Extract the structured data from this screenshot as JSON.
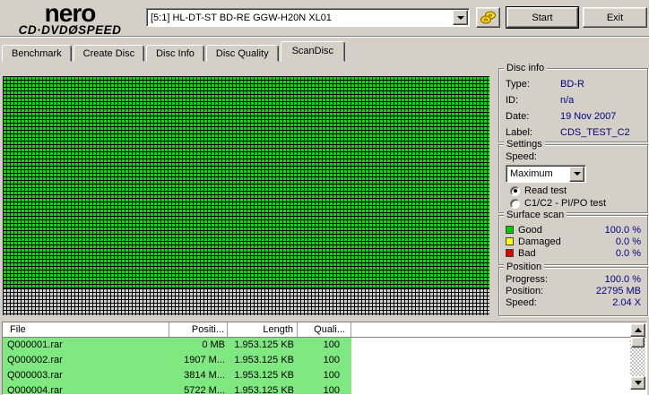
{
  "window": {
    "brand": "nero",
    "product": "CD·DVDØSPEED",
    "drive_selector": "[5:1]  HL-DT-ST BD-RE  GGW-H20N XL01",
    "start_label": "Start",
    "exit_label": "Exit"
  },
  "tabs": [
    {
      "label": "Benchmark"
    },
    {
      "label": "Create Disc"
    },
    {
      "label": "Disc Info"
    },
    {
      "label": "Disc Quality"
    },
    {
      "label": "ScanDisc"
    }
  ],
  "active_tab": "ScanDisc",
  "scan_grid": {
    "good_color": "#00dd00",
    "unscanned_color": "#cdcdcd",
    "grid_line_color": "#000000",
    "scanned_fraction": 0.888
  },
  "disc_info": {
    "title": "Disc info",
    "rows": [
      {
        "label": "Type:",
        "value": "BD-R"
      },
      {
        "label": "ID:",
        "value": "n/a"
      },
      {
        "label": "Date:",
        "value": "19 Nov 2007"
      },
      {
        "label": "Label:",
        "value": "CDS_TEST_C2"
      }
    ]
  },
  "settings": {
    "title": "Settings",
    "speed_label": "Speed:",
    "speed_value": "Maximum",
    "radio_read": "Read test",
    "radio_c1c2": "C1/C2 - PI/PO test",
    "selected_radio": "Read test"
  },
  "surface_scan": {
    "title": "Surface scan",
    "rows": [
      {
        "label": "Good",
        "color": "#00cc00",
        "value": "100.0 %"
      },
      {
        "label": "Damaged",
        "color": "#ffff00",
        "value": "0.0 %"
      },
      {
        "label": "Bad",
        "color": "#dd0000",
        "value": "0.0 %"
      }
    ]
  },
  "position": {
    "title": "Position",
    "rows": [
      {
        "label": "Progress:",
        "value": "100.0 %"
      },
      {
        "label": "Position:",
        "value": "22795 MB"
      },
      {
        "label": "Speed:",
        "value": "2.04 X"
      }
    ]
  },
  "file_table": {
    "row_color": "#80e880",
    "headers": [
      "File",
      "Positi...",
      "Length",
      "Quali..."
    ],
    "rows": [
      {
        "file": "Q000001.rar",
        "position": "0 MB",
        "length": "1.953.125 KB",
        "quality": "100"
      },
      {
        "file": "Q000002.rar",
        "position": "1907 M...",
        "length": "1.953.125 KB",
        "quality": "100"
      },
      {
        "file": "Q000003.rar",
        "position": "3814 M...",
        "length": "1.953.125 KB",
        "quality": "100"
      },
      {
        "file": "Q000004.rar",
        "position": "5722 M...",
        "length": "1.953.125 KB",
        "quality": "100"
      }
    ]
  }
}
